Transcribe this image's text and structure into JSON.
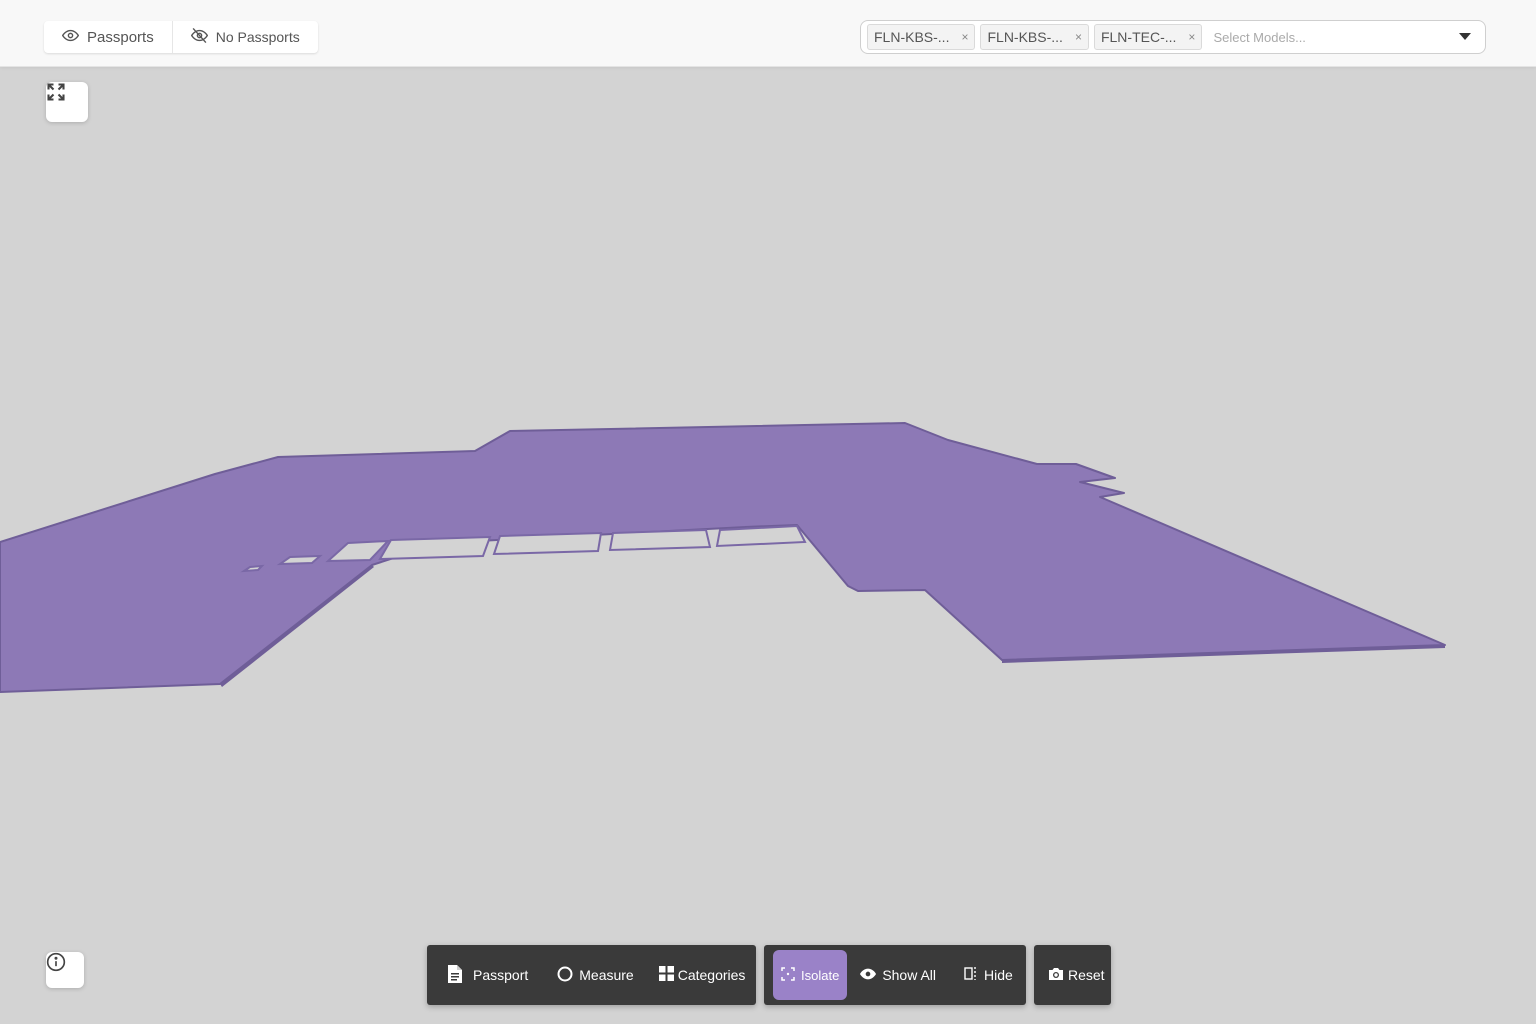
{
  "header": {
    "passport_toggle": {
      "passports_label": "Passports",
      "no_passports_label": "No Passports"
    },
    "model_select": {
      "chips": [
        "FLN-KBS-...",
        "FLN-KBS-...",
        "FLN-TEC-..."
      ],
      "remove_glyph": "×",
      "placeholder": "Select Models..."
    }
  },
  "viewport": {
    "background_color": "#d3d3d3",
    "model_color": "#8d79b6",
    "model_edge_color": "#6f5e98"
  },
  "toolbar": {
    "groups": [
      {
        "buttons": [
          {
            "label": "Passport",
            "icon": "document-icon"
          },
          {
            "label": "Measure",
            "icon": "circle-icon"
          },
          {
            "label": "Categories",
            "icon": "grid-icon"
          }
        ]
      },
      {
        "buttons": [
          {
            "label": "Isolate",
            "icon": "isolate-icon",
            "active": true
          },
          {
            "label": "Show All",
            "icon": "eye-icon"
          },
          {
            "label": "Hide",
            "icon": "hide-icon"
          }
        ]
      },
      {
        "buttons": [
          {
            "label": "Reset",
            "icon": "camera-icon"
          }
        ]
      }
    ],
    "active_color": "#9a82c8"
  }
}
